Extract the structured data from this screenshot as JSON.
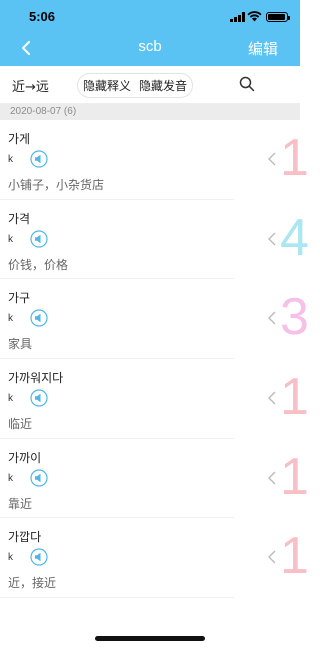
{
  "status_bar": {
    "time": "5:06"
  },
  "header": {
    "title": "scb",
    "edit_label": "编辑",
    "back_icon": "chevron-left-icon"
  },
  "toolbar": {
    "sort_label": "近→远",
    "hide_meaning_label": "隐藏释义",
    "hide_pronunciation_label": "隐藏发音",
    "search_icon": "search-icon"
  },
  "date_group": {
    "label": "2020-08-07 (6)"
  },
  "words": [
    {
      "word": "가게",
      "phonetic": "k",
      "meaning": "小铺子，小杂货店",
      "level": "1",
      "level_color": "#f7b6bd"
    },
    {
      "word": "가격",
      "phonetic": "k",
      "meaning": "价钱，价格",
      "level": "4",
      "level_color": "#9ee3ef"
    },
    {
      "word": "가구",
      "phonetic": "k",
      "meaning": "家具",
      "level": "3",
      "level_color": "#f6b6e6"
    },
    {
      "word": "가까워지다",
      "phonetic": "k",
      "meaning": "临近",
      "level": "1",
      "level_color": "#f7b6bd"
    },
    {
      "word": "가까이",
      "phonetic": "k",
      "meaning": "靠近",
      "level": "1",
      "level_color": "#f7b6bd"
    },
    {
      "word": "가깝다",
      "phonetic": "k",
      "meaning": "近，接近",
      "level": "1",
      "level_color": "#f7b6bd"
    }
  ],
  "colors": {
    "header_bg": "#5bc3f3",
    "speaker": "#4fb7e8"
  }
}
